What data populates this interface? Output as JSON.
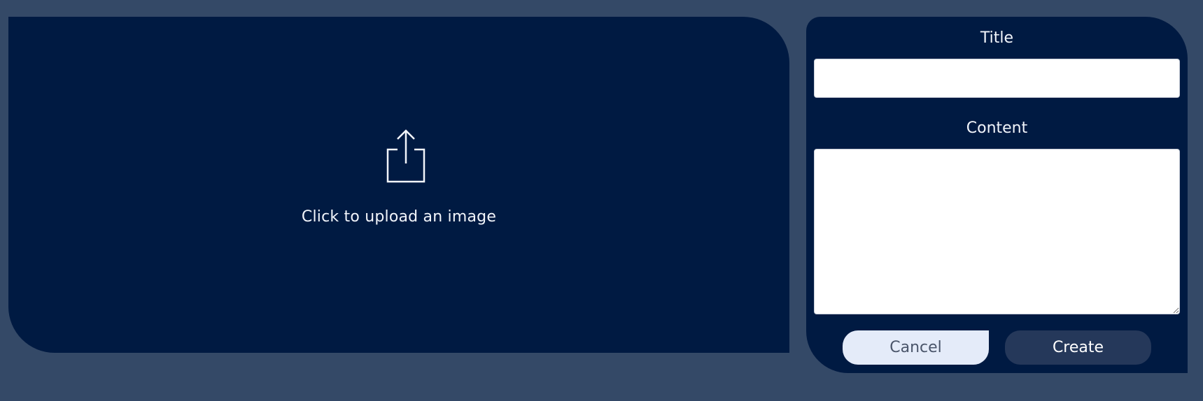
{
  "upload": {
    "prompt": "Click to upload an image",
    "icon": "share-upload-icon"
  },
  "form": {
    "title_label": "Title",
    "title_value": "",
    "content_label": "Content",
    "content_value": "",
    "cancel_label": "Cancel",
    "create_label": "Create"
  },
  "colors": {
    "page_background": "#344967",
    "panel_background": "#001a42",
    "cancel_background": "#e4ebf9",
    "create_background": "#25385a"
  }
}
